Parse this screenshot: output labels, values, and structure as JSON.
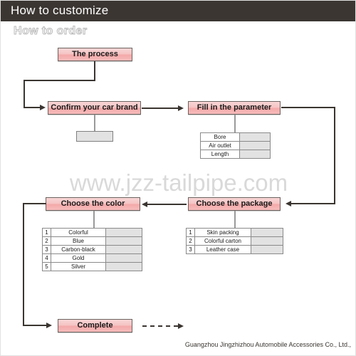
{
  "header": {
    "title": "How to customize"
  },
  "subtitle": "How to order",
  "watermark": "www.jzz-tailpipe.com",
  "footer": "Guangzhou Jingzhizhou Automobile Accessories Co., Ltd.,",
  "nodes": {
    "process": "The process",
    "confirm_brand": "Confirm your car brand",
    "fill_parameter": "Fill in the parameter",
    "choose_color": "Choose the color",
    "choose_package": "Choose the package",
    "complete": "Complete"
  },
  "parameter_table": {
    "rows": [
      {
        "label": "Bore",
        "value": ""
      },
      {
        "label": "Air outlet",
        "value": ""
      },
      {
        "label": "Length",
        "value": ""
      }
    ]
  },
  "color_table": {
    "rows": [
      {
        "num": "1",
        "label": "Colorful",
        "value": ""
      },
      {
        "num": "2",
        "label": "Blue",
        "value": ""
      },
      {
        "num": "3",
        "label": "Carbon-black",
        "value": ""
      },
      {
        "num": "4",
        "label": "Gold",
        "value": ""
      },
      {
        "num": "5",
        "label": "Silver",
        "value": ""
      }
    ]
  },
  "package_table": {
    "rows": [
      {
        "num": "1",
        "label": "Skin packing",
        "value": ""
      },
      {
        "num": "2",
        "label": "Colorful carton",
        "value": ""
      },
      {
        "num": "3",
        "label": "Leather case",
        "value": ""
      }
    ]
  },
  "colors": {
    "header_bg": "#3b3632",
    "node_fill": "#f4a9a9",
    "node_border": "#6b6460",
    "line": "#3a3530",
    "table_value_bg": "#e2e2e2",
    "watermark": "#d9d9d9"
  }
}
